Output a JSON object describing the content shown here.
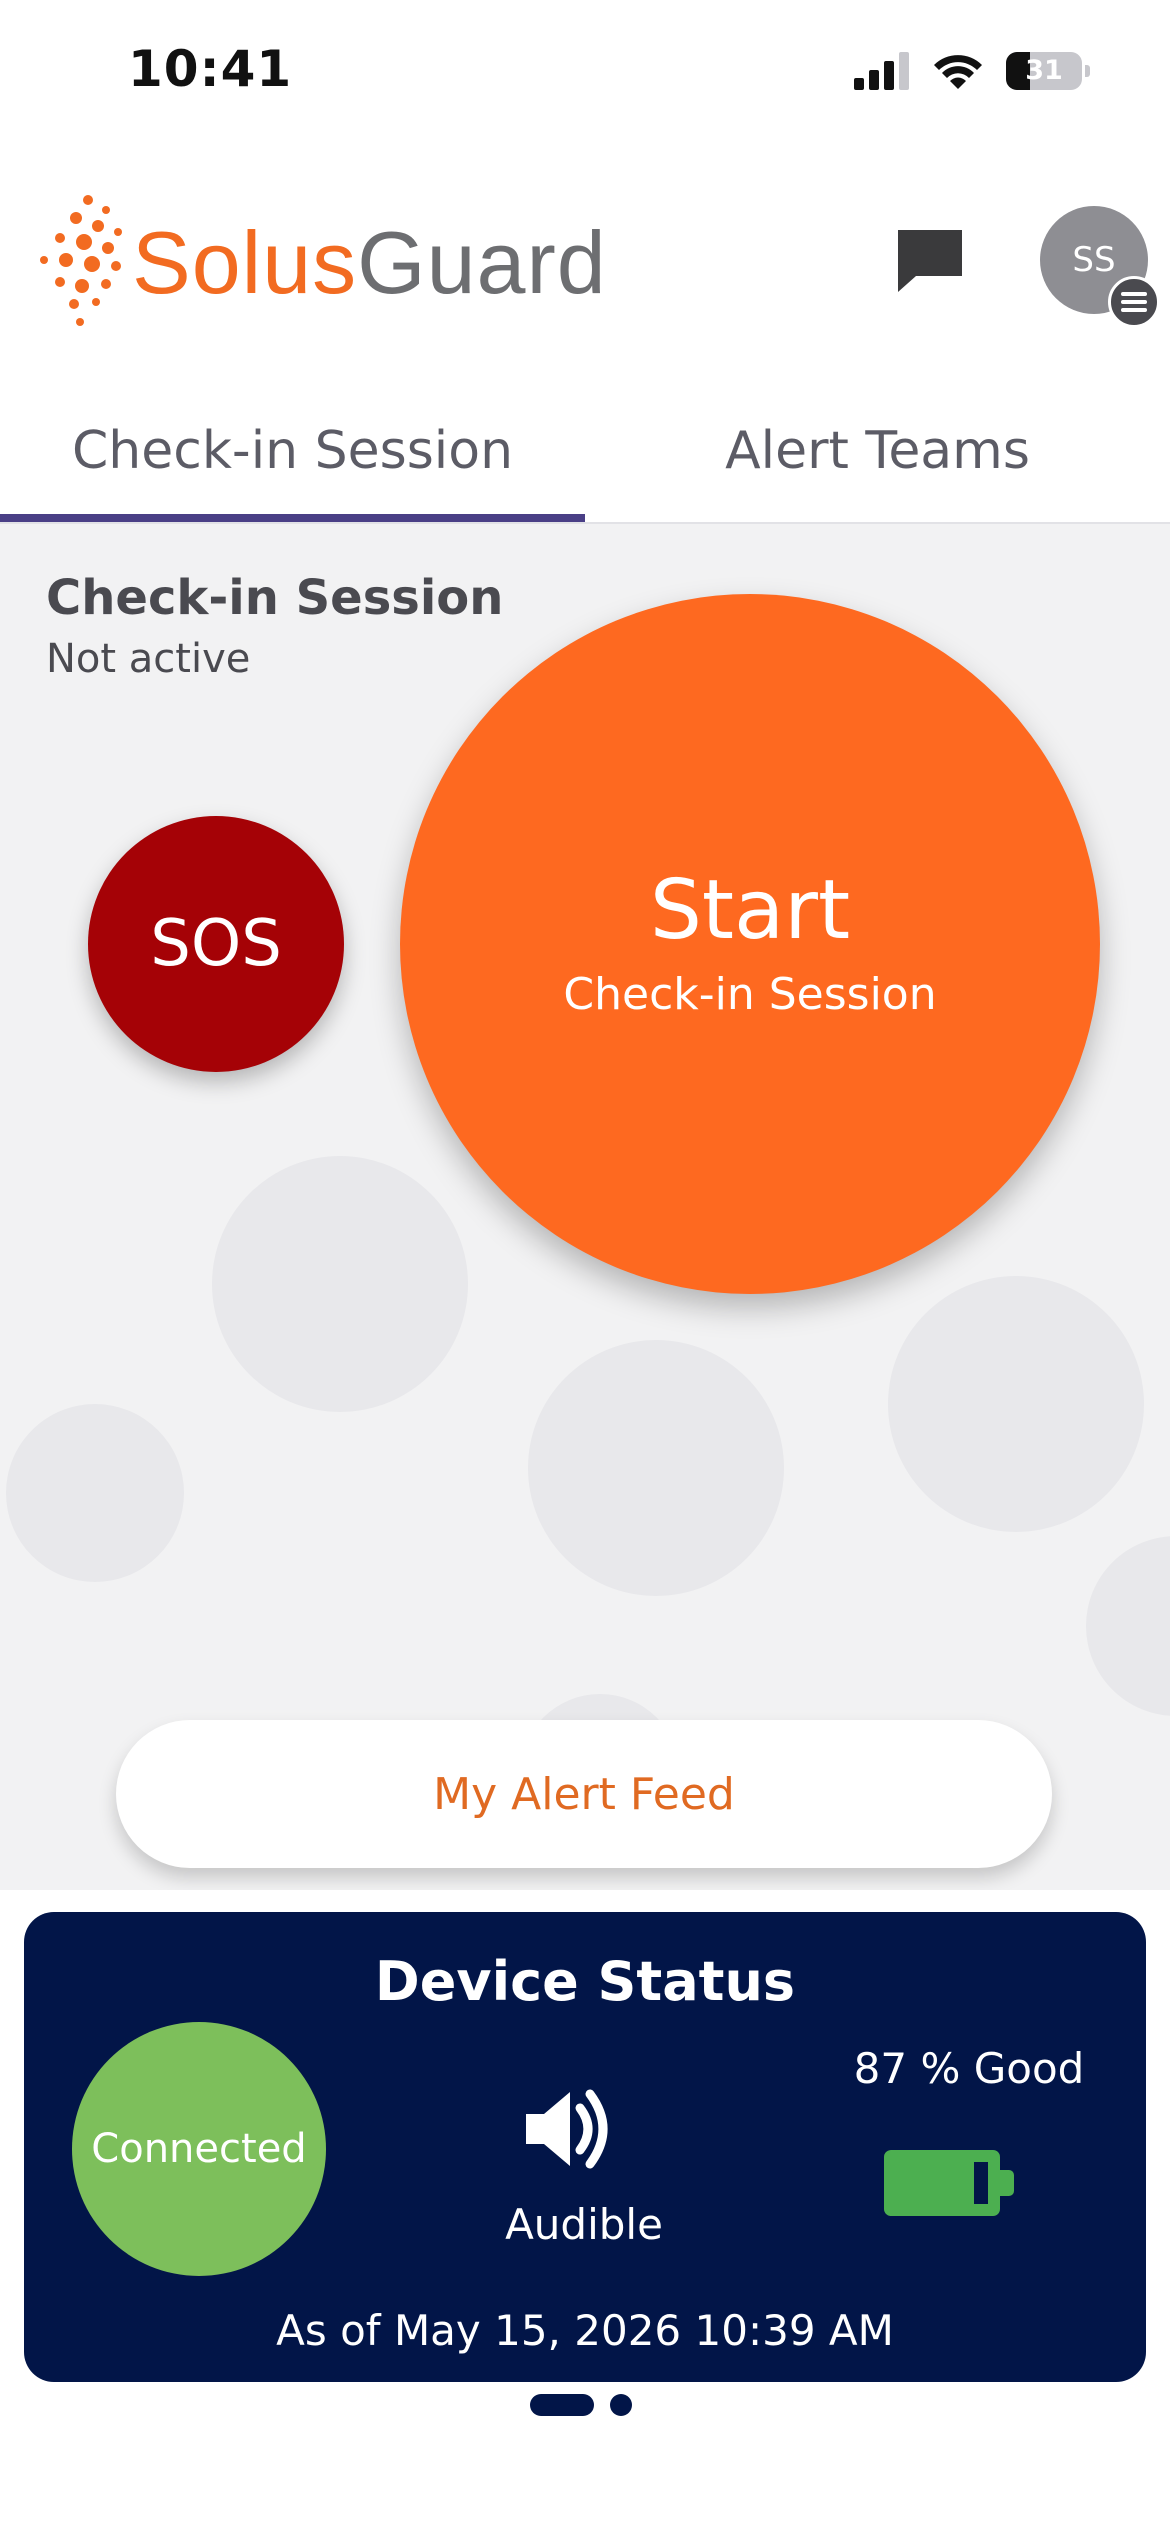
{
  "status_bar": {
    "time": "10:41",
    "battery_level": "31",
    "icons": [
      "cellular-signal-icon",
      "wifi-icon",
      "battery-icon"
    ]
  },
  "header": {
    "logo": {
      "part1": "Solus",
      "part2": "Guard"
    },
    "avatar_initials": "SS",
    "icons": [
      "chat-icon",
      "menu-icon"
    ]
  },
  "tabs": [
    {
      "label": "Check-in Session",
      "active": true
    },
    {
      "label": "Alert Teams",
      "active": false
    }
  ],
  "session": {
    "title": "Check-in Session",
    "status": "Not active"
  },
  "sos_button": {
    "label": "SOS"
  },
  "start_button": {
    "label": "Start",
    "sublabel": "Check-in Session"
  },
  "alert_feed_button": {
    "label": "My Alert Feed"
  },
  "device_status": {
    "title": "Device Status",
    "connection": "Connected",
    "audio_label": "Audible",
    "battery": "87 % Good",
    "timestamp": "As of May 15, 2026 10:39 AM"
  },
  "page_indicator": {
    "count": 2,
    "active_index": 0
  },
  "colors": {
    "brand_orange": "#fe6920",
    "sos_red": "#a50206",
    "navy": "#021548",
    "connected_green": "#7dbf5b",
    "battery_green": "#4caf50",
    "tab_indicator": "#4a3f86"
  }
}
